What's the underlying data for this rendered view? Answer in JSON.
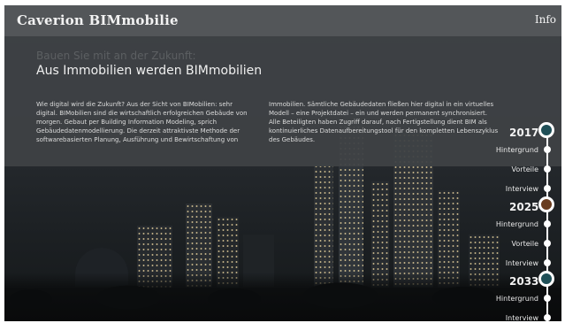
{
  "app": {
    "title": "Caverion BIMmobilie",
    "info_label": "Info"
  },
  "intro": {
    "kicker": "Bauen Sie mit an der Zukunft:",
    "headline": "Aus Immobilien werden BIMmobilien",
    "paragraph_left": "Wie digital wird die Zukunft? Aus der Sicht von BIMobilien: sehr digital. BIMobilien sind die wirtschaftlich erfolgreichen Gebäude von morgen. Gebaut per Building Information Modeling, sprich Gebäudedatenmodellierung. Die derzeit attraktivste Methode der softwarebasierten Planung, Ausführung und Bewirtschaftung von",
    "paragraph_right": "Immobilien. Sämtliche Gebäudedaten fließen hier digital in ein virtuelles Modell – eine Projektdatei – ein und werden permanent synchronisiert. Alle Beteiligten haben Zugriff darauf, nach Fertigstellung dient BIM als kontinuierliches Datenaufbereitungstool für den kompletten Lebenszyklus des Gebäudes."
  },
  "timeline": {
    "years": [
      {
        "year": "2017",
        "color": "#1f4f57",
        "items": [
          "Hintergrund",
          "Vorteile",
          "Interview"
        ]
      },
      {
        "year": "2025",
        "color": "#6a3d1f",
        "items": [
          "Hintergrund",
          "Vorteile",
          "Interview"
        ]
      },
      {
        "year": "2033",
        "color": "#1f4f57",
        "items": [
          "Hintergrund",
          "Interview"
        ]
      }
    ]
  },
  "icons": {
    "timeline_marker": "circle-marker-icon",
    "timeline_dot": "dot-icon"
  }
}
